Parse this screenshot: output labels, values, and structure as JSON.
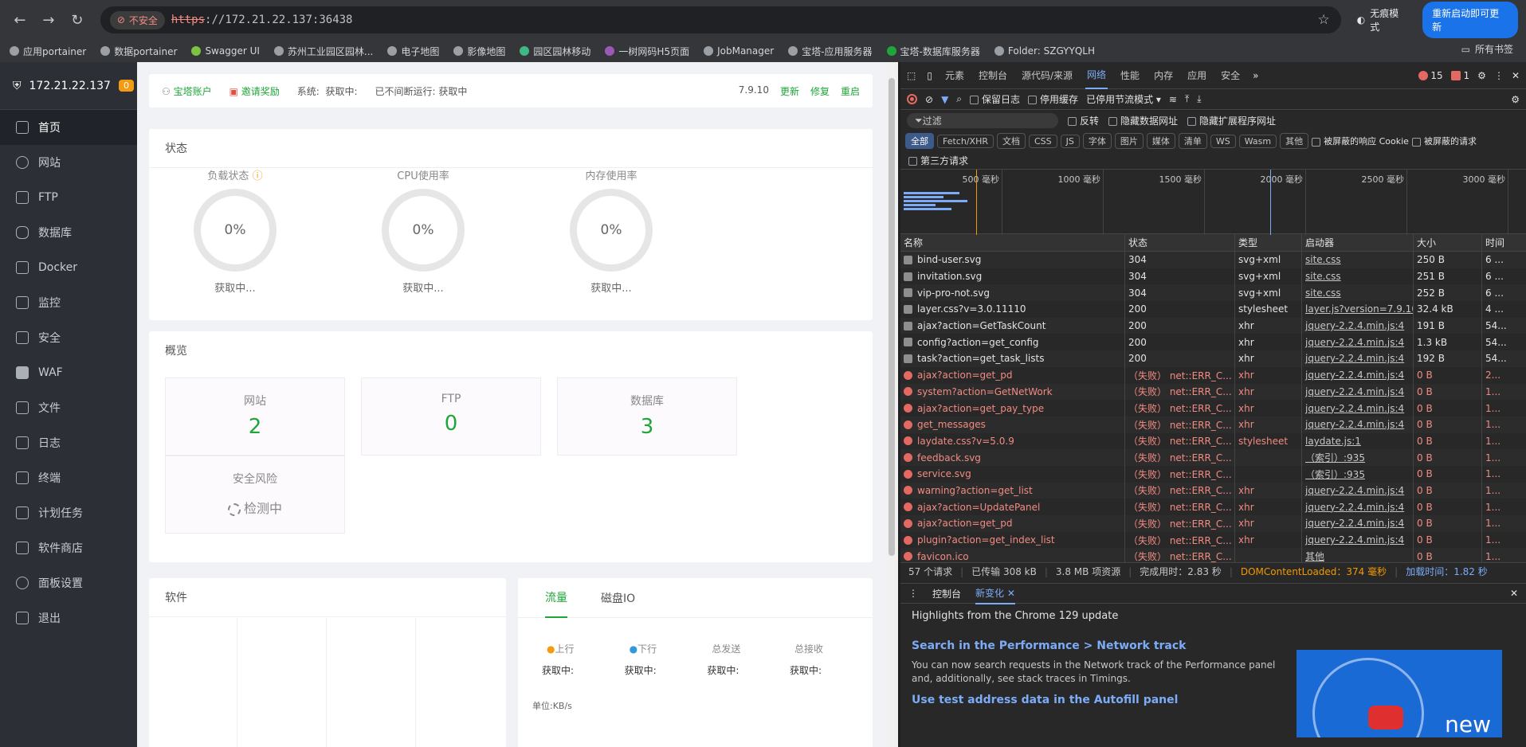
{
  "browser": {
    "insecure_label": "不安全",
    "url_proto": "https",
    "url_rest": "://172.21.22.137:36438",
    "incognito_label": "无痕模式",
    "update_label": "重新启动即可更新",
    "bookmarks": [
      "应用portainer",
      "数据portainer",
      "Swagger UI",
      "苏州工业园区园林...",
      "电子地图",
      "影像地图",
      "园区园林移动",
      "一树网码H5页面",
      "JobManager",
      "宝塔-应用服务器",
      "宝塔-数据库服务器",
      "Folder: SZGYYQLH"
    ],
    "all_bookmarks": "所有书签"
  },
  "sidebar": {
    "host": "172.21.22.137",
    "badge": "0",
    "items": [
      {
        "label": "首页"
      },
      {
        "label": "网站"
      },
      {
        "label": "FTP"
      },
      {
        "label": "数据库"
      },
      {
        "label": "Docker"
      },
      {
        "label": "监控"
      },
      {
        "label": "安全"
      },
      {
        "label": "WAF"
      },
      {
        "label": "文件"
      },
      {
        "label": "日志"
      },
      {
        "label": "终端"
      },
      {
        "label": "计划任务"
      },
      {
        "label": "软件商店"
      },
      {
        "label": "面板设置"
      },
      {
        "label": "退出"
      }
    ]
  },
  "topbar": {
    "account": "宝塔账户",
    "invite": "邀请奖励",
    "system": "系统:",
    "system_val": "获取中:",
    "uptime": "已不间断运行: 获取中",
    "version": "7.9.10",
    "update": "更新",
    "repair": "修复",
    "restart": "重启"
  },
  "status": {
    "title": "状态",
    "gauges": [
      {
        "label": "负载状态",
        "value": "0%",
        "state": "获取中..."
      },
      {
        "label": "CPU使用率",
        "value": "0%",
        "state": "获取中..."
      },
      {
        "label": "内存使用率",
        "value": "0%",
        "state": "获取中..."
      }
    ]
  },
  "overview": {
    "title": "概览",
    "items": [
      {
        "label": "网站",
        "value": "2"
      },
      {
        "label": "FTP",
        "value": "0"
      },
      {
        "label": "数据库",
        "value": "3"
      }
    ],
    "risk_label": "安全风险",
    "risk_state": "检测中"
  },
  "software": {
    "title": "软件"
  },
  "traffic": {
    "tab_flow": "流量",
    "tab_disk": "磁盘IO",
    "cols": [
      {
        "label": "上行",
        "val": "获取中:"
      },
      {
        "label": "下行",
        "val": "获取中:"
      },
      {
        "label": "总发送",
        "val": "获取中:"
      },
      {
        "label": "总接收",
        "val": "获取中:"
      }
    ],
    "unit": "单位:KB/s"
  },
  "devtools": {
    "tabs": [
      "元素",
      "控制台",
      "源代码/来源",
      "网络",
      "性能",
      "内存",
      "应用",
      "安全"
    ],
    "err_count": "15",
    "warn_count": "1",
    "preserve_log": "保留日志",
    "disable_cache": "停用缓存",
    "throttle": "已停用节流模式",
    "filter_placeholder": "过滤",
    "invert": "反转",
    "hide_data": "隐藏数据网址",
    "hide_ext": "隐藏扩展程序网址",
    "types": [
      "全部",
      "Fetch/XHR",
      "文档",
      "CSS",
      "JS",
      "字体",
      "图片",
      "媒体",
      "清单",
      "WS",
      "Wasm",
      "其他"
    ],
    "blocked_cookies": "被屏蔽的响应 Cookie",
    "blocked_req": "被屏蔽的请求",
    "third_party": "第三方请求",
    "ticks": [
      "500 毫秒",
      "1000 毫秒",
      "1500 毫秒",
      "2000 毫秒",
      "2500 毫秒",
      "3000 毫秒"
    ],
    "headers": [
      "名称",
      "状态",
      "类型",
      "启动器",
      "大小",
      "时间"
    ],
    "requests": [
      {
        "name": "bind-user.svg",
        "status": "304",
        "type": "svg+xml",
        "init": "site.css",
        "size": "250 B",
        "time": "6 ...",
        "fail": false
      },
      {
        "name": "invitation.svg",
        "status": "304",
        "type": "svg+xml",
        "init": "site.css",
        "size": "251 B",
        "time": "6 ...",
        "fail": false
      },
      {
        "name": "vip-pro-not.svg",
        "status": "304",
        "type": "svg+xml",
        "init": "site.css",
        "size": "252 B",
        "time": "6 ...",
        "fail": false
      },
      {
        "name": "layer.css?v=3.0.11110",
        "status": "200",
        "type": "stylesheet",
        "init": "layer.js?version=7.9.10:1",
        "size": "32.4 kB",
        "time": "4 ...",
        "fail": false
      },
      {
        "name": "ajax?action=GetTaskCount",
        "status": "200",
        "type": "xhr",
        "init": "jquery-2.2.4.min.js:4",
        "size": "191 B",
        "time": "54...",
        "fail": false
      },
      {
        "name": "config?action=get_config",
        "status": "200",
        "type": "xhr",
        "init": "jquery-2.2.4.min.js:4",
        "size": "1.3 kB",
        "time": "54...",
        "fail": false
      },
      {
        "name": "task?action=get_task_lists",
        "status": "200",
        "type": "xhr",
        "init": "jquery-2.2.4.min.js:4",
        "size": "192 B",
        "time": "54...",
        "fail": false
      },
      {
        "name": "ajax?action=get_pd",
        "status": "（失败） net::ERR_C...",
        "type": "xhr",
        "init": "jquery-2.2.4.min.js:4",
        "size": "0 B",
        "time": "2...",
        "fail": true
      },
      {
        "name": "system?action=GetNetWork",
        "status": "（失败） net::ERR_C...",
        "type": "xhr",
        "init": "jquery-2.2.4.min.js:4",
        "size": "0 B",
        "time": "1...",
        "fail": true
      },
      {
        "name": "ajax?action=get_pay_type",
        "status": "（失败） net::ERR_C...",
        "type": "xhr",
        "init": "jquery-2.2.4.min.js:4",
        "size": "0 B",
        "time": "1...",
        "fail": true
      },
      {
        "name": "get_messages",
        "status": "（失败） net::ERR_C...",
        "type": "xhr",
        "init": "jquery-2.2.4.min.js:4",
        "size": "0 B",
        "time": "1...",
        "fail": true
      },
      {
        "name": "laydate.css?v=5.0.9",
        "status": "（失败） net::ERR_C...",
        "type": "stylesheet",
        "init": "laydate.js:1",
        "size": "0 B",
        "time": "1...",
        "fail": true
      },
      {
        "name": "feedback.svg",
        "status": "（失败） net::ERR_C...",
        "type": "",
        "init": "（索引）:935",
        "size": "0 B",
        "time": "1...",
        "fail": true
      },
      {
        "name": "service.svg",
        "status": "（失败） net::ERR_C...",
        "type": "",
        "init": "（索引）:935",
        "size": "0 B",
        "time": "1...",
        "fail": true
      },
      {
        "name": "warning?action=get_list",
        "status": "（失败） net::ERR_C...",
        "type": "xhr",
        "init": "jquery-2.2.4.min.js:4",
        "size": "0 B",
        "time": "1...",
        "fail": true
      },
      {
        "name": "ajax?action=UpdatePanel",
        "status": "（失败） net::ERR_C...",
        "type": "xhr",
        "init": "jquery-2.2.4.min.js:4",
        "size": "0 B",
        "time": "1...",
        "fail": true
      },
      {
        "name": "ajax?action=get_pd",
        "status": "（失败） net::ERR_C...",
        "type": "xhr",
        "init": "jquery-2.2.4.min.js:4",
        "size": "0 B",
        "time": "1...",
        "fail": true
      },
      {
        "name": "plugin?action=get_index_list",
        "status": "（失败） net::ERR_C...",
        "type": "xhr",
        "init": "jquery-2.2.4.min.js:4",
        "size": "0 B",
        "time": "1...",
        "fail": true
      },
      {
        "name": "favicon.ico",
        "status": "（失败） net::ERR_C...",
        "type": "",
        "init": "其他",
        "size": "0 B",
        "time": "1...",
        "fail": true
      }
    ],
    "status_bar": [
      "57 个请求",
      "已传输 308 kB",
      "3.8 MB 项资源",
      "完成用时：2.83 秒"
    ],
    "dom_loaded": "DOMContentLoaded：374 毫秒",
    "load_time": "加载时间：1.82 秒",
    "drawer_tabs": [
      "控制台",
      "新变化"
    ],
    "drawer_headline": "Highlights from the Chrome 129 update",
    "news1_title": "Search in the Performance > Network track",
    "news1_body": "You can now search requests in the Network track of the Performance panel and, additionally, see stack traces in Timings.",
    "news2_title": "Use test address data in the Autofill panel",
    "news_img_text": "new"
  }
}
